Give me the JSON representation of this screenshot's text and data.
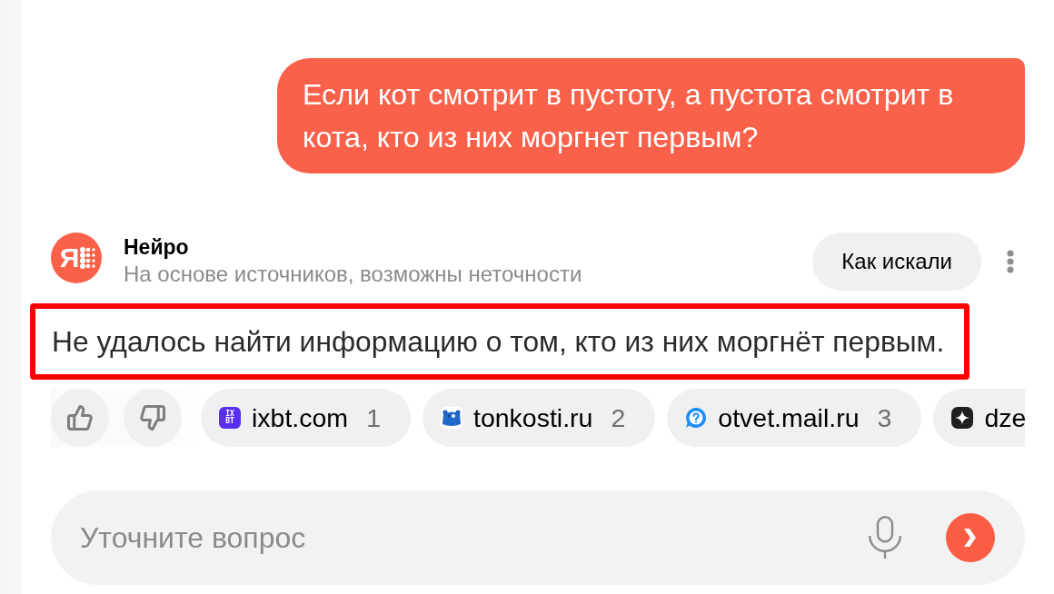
{
  "user_message": {
    "text": "Если кот смотрит в пустоту, а пустота смотрит в кота, кто из них моргнет первым?"
  },
  "response": {
    "author": "Нейро",
    "logo_letter": "Я",
    "disclaimer": "На основе источников, возможны неточности",
    "how_searched_button": "Как искали",
    "answer": {
      "text": "Не удалось найти информацию о том, кто из них моргнёт первым.",
      "highlighted": true
    }
  },
  "sources": [
    {
      "kind": "ixbt",
      "name": "ixbt.com",
      "number": "1",
      "logo_text": [
        "IX",
        "BT"
      ]
    },
    {
      "kind": "tonkosti",
      "name": "tonkosti.ru",
      "number": "2"
    },
    {
      "kind": "otvet",
      "name": "otvet.mail.ru",
      "number": "3"
    },
    {
      "kind": "dzen",
      "name": "dze"
    }
  ],
  "composer": {
    "placeholder": "Уточните вопрос"
  }
}
